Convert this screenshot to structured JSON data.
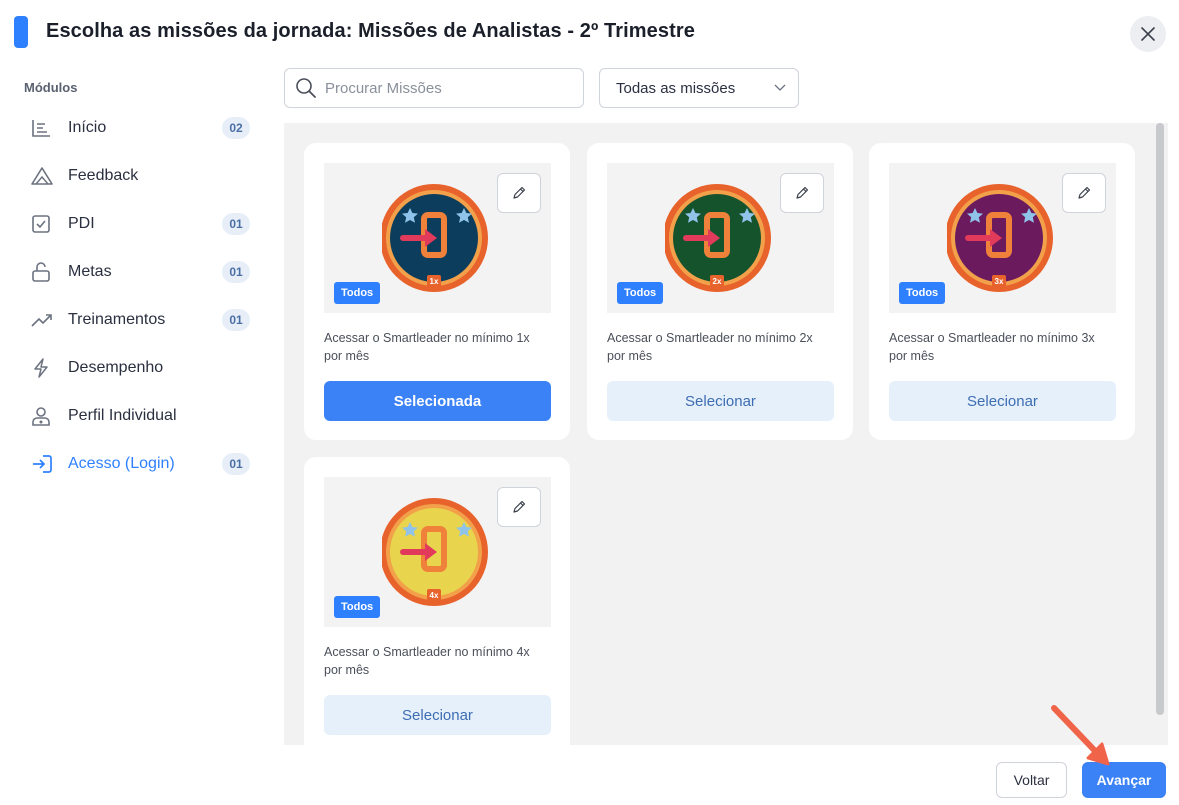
{
  "header": {
    "title": "Escolha as missões da jornada: Missões de Analistas - 2º Trimestre",
    "close_icon": "close-icon"
  },
  "sidebar": {
    "heading": "Módulos",
    "items": [
      {
        "label": "Início",
        "badge": "02",
        "icon": "chart-bars-icon",
        "active": false
      },
      {
        "label": "Feedback",
        "badge": "",
        "icon": "triangle-icon",
        "active": false
      },
      {
        "label": "PDI",
        "badge": "01",
        "icon": "checkbox-icon",
        "active": false
      },
      {
        "label": "Metas",
        "badge": "01",
        "icon": "unlock-icon",
        "active": false
      },
      {
        "label": "Treinamentos",
        "badge": "01",
        "icon": "trending-up-icon",
        "active": false
      },
      {
        "label": "Desempenho",
        "badge": "",
        "icon": "lightning-icon",
        "active": false
      },
      {
        "label": "Perfil Individual",
        "badge": "",
        "icon": "user-profile-icon",
        "active": false
      },
      {
        "label": "Acesso (Login)",
        "badge": "01",
        "icon": "login-icon",
        "active": true
      }
    ]
  },
  "toolbar": {
    "search_placeholder": "Procurar Missões",
    "filter_value": "Todas as missões"
  },
  "cards": [
    {
      "tag": "Todos",
      "multiplier": "1x",
      "medal_color": "#0c3d5c",
      "description": "Acessar o Smartleader no mínimo 1x por mês",
      "action": "Selecionada",
      "selected": true
    },
    {
      "tag": "Todos",
      "multiplier": "2x",
      "medal_color": "#15532d",
      "description": "Acessar o Smartleader no mínimo 2x por mês",
      "action": "Selecionar",
      "selected": false
    },
    {
      "tag": "Todos",
      "multiplier": "3x",
      "medal_color": "#6b1a5e",
      "description": "Acessar o Smartleader no mínimo 3x por mês",
      "action": "Selecionar",
      "selected": false
    },
    {
      "tag": "Todos",
      "multiplier": "4x",
      "medal_color": "#e8d54d",
      "description": "Acessar o Smartleader no mínimo 4x por mês",
      "action": "Selecionar",
      "selected": false
    }
  ],
  "footer": {
    "back_label": "Voltar",
    "next_label": "Avançar"
  },
  "colors": {
    "accent": "#2f80ff",
    "annotation_arrow": "#f0644a"
  }
}
